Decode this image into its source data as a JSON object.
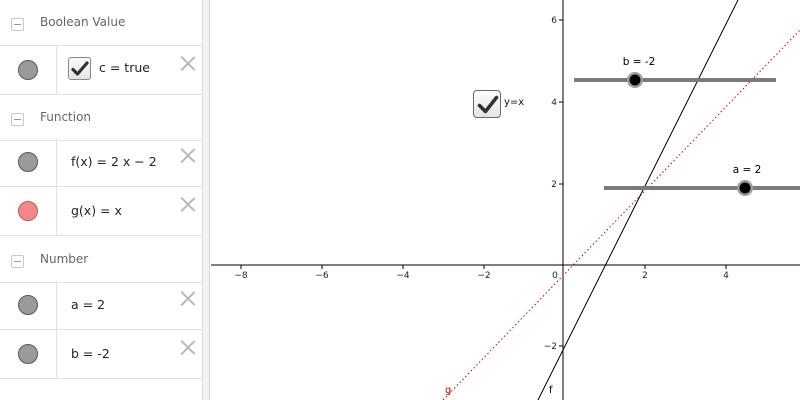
{
  "algebra": {
    "groups": [
      {
        "title": "Boolean Value",
        "items": [
          {
            "formula": "c = true",
            "color": "#9a9a9a",
            "checked": true
          }
        ]
      },
      {
        "title": "Function",
        "items": [
          {
            "formula": "f(x) = 2 x − 2",
            "color": "#9a9a9a"
          },
          {
            "formula": "g(x) = x",
            "color": "#f2878a"
          }
        ]
      },
      {
        "title": "Number",
        "items": [
          {
            "formula": "a = 2",
            "color": "#9a9a9a"
          },
          {
            "formula": "b = -2",
            "color": "#9a9a9a"
          }
        ]
      }
    ],
    "icons": {
      "collapse": "minus-collapse-icon",
      "delete": "close-x-icon",
      "checkmark": "checkmark-icon"
    }
  },
  "graphics": {
    "checkbox": {
      "label": "y=x",
      "checked": true
    },
    "x_ticks": [
      "−8",
      "−6",
      "−4",
      "−2",
      "0",
      "2",
      "4"
    ],
    "y_ticks": [
      "−2",
      "2",
      "4",
      "6"
    ],
    "line_labels": {
      "f": "f",
      "g": "g"
    },
    "sliders": {
      "a": {
        "label": "a = 2",
        "value": 2
      },
      "b": {
        "label": "b = -2",
        "value": -2
      }
    },
    "colors": {
      "f": "#000000",
      "g": "#cc0000",
      "slider_track": "#7a7a7a",
      "axis": "#000000"
    }
  }
}
